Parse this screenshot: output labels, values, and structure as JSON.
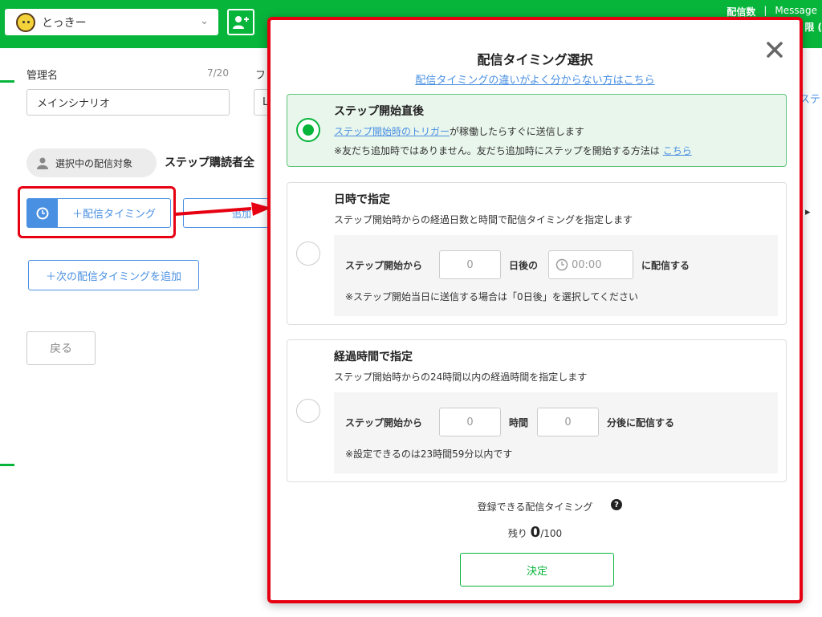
{
  "header": {
    "account_name": "とっきー",
    "messages_label": "配信数",
    "messages_label2": "Message",
    "plan_partial": "限 ("
  },
  "form": {
    "name_label": "管理名",
    "name_counter": "7/20",
    "name_value": "メインシナリオ",
    "second_label_partial": "フ",
    "second_value_partial": "L",
    "target_label": "選択中の配信対象",
    "target_value": "ステップ購読者全",
    "timing_button": "＋配信タイミング",
    "other_partial": "追加",
    "next_timing_button": "＋次の配信タイミングを追加",
    "back_button": "戻る",
    "right_partial": "ステ"
  },
  "modal": {
    "title": "配信タイミング選択",
    "help_link": "配信タイミングの違いがよく分からない方はこちら",
    "options": [
      {
        "title": "ステップ開始直後",
        "desc_link": "ステップ開始時のトリガー",
        "desc_rest": "が稼働したらすぐに送信します",
        "note": "※友だち追加時ではありません。友だち追加時にステップを開始する方法は",
        "note_link": "こちら",
        "selected": true
      },
      {
        "title": "日時で指定",
        "desc": "ステップ開始時からの経過日数と時間で配信タイミングを指定します",
        "prefix": "ステップ開始から",
        "days_value": "0",
        "days_unit": "日後の",
        "time_placeholder": "00:00",
        "suffix": "に配信する",
        "note": "※ステップ開始当日に送信する場合は「0日後」を選択してください",
        "selected": false
      },
      {
        "title": "経過時間で指定",
        "desc": "ステップ開始時からの24時間以内の経過時間を指定します",
        "prefix": "ステップ開始から",
        "hours_value": "0",
        "hours_unit": "時間",
        "minutes_value": "0",
        "suffix": "分後に配信する",
        "note": "※設定できるのは23時間59分以内です",
        "selected": false
      }
    ],
    "register_label": "登録できる配信タイミング",
    "remain_prefix": "残り",
    "remain_value": "0",
    "remain_total": "/100",
    "confirm_button": "決定"
  },
  "colors": {
    "brand_green": "#07b53b",
    "link_blue": "#4a90e2",
    "highlight_red": "#e60012"
  }
}
